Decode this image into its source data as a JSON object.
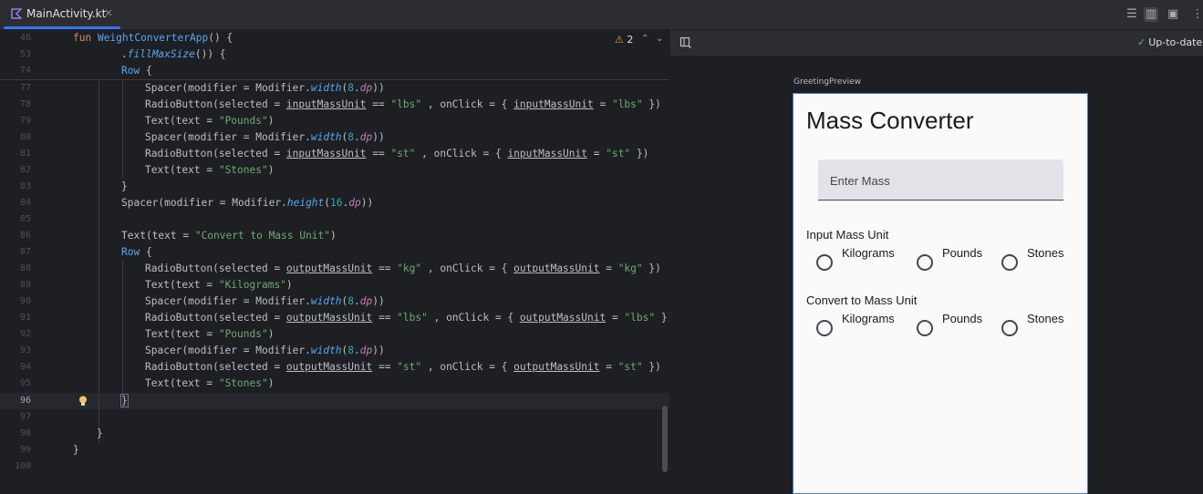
{
  "tab": {
    "file_name": "MainActivity.kt",
    "close": "×"
  },
  "toolbar": {
    "code_view": "☰",
    "split_view": "▥",
    "design_view": "▣",
    "more": "⋮"
  },
  "editor": {
    "warnings_count": "2",
    "warning_icon": "⚠",
    "nav_up": "⌃",
    "nav_down": "⌄",
    "line_numbers": [
      "46",
      "53",
      "74",
      "77",
      "78",
      "79",
      "80",
      "81",
      "82",
      "83",
      "84",
      "85",
      "86",
      "87",
      "88",
      "89",
      "90",
      "91",
      "92",
      "93",
      "94",
      "95",
      "96",
      "97",
      "98",
      "99",
      "100"
    ],
    "current_line": "96",
    "code": {
      "l46_kw": "fun ",
      "l46_fn": "WeightConverterApp",
      "l46_rest": "() {",
      "l53_dot": ".",
      "l53_fn": "fillMaxSize",
      "l53_rest": "()) {",
      "l74_row": "Row",
      "l74_rest": " {",
      "spacer_call": "Spacer(modifier = Modifier.",
      "width_fn": "width",
      "height_fn": "height",
      "dp_ext": "dp",
      "num_8": "8",
      "num_16": "16",
      "close_2": "))",
      "radio_open": "RadioButton(selected = ",
      "input_var": "inputMassUnit",
      "output_var": "outputMassUnit",
      "eq": " == ",
      "onclick": " , onClick = { ",
      "assign": " = ",
      "close_brace": " })",
      "str_lbs": "\"lbs\"",
      "str_st": "\"st\"",
      "str_kg": "\"kg\"",
      "text_open": "Text(text = ",
      "str_pounds": "\"Pounds\"",
      "str_stones": "\"Stones\"",
      "str_kilograms": "\"Kilograms\"",
      "str_convert": "\"Convert to Mass Unit\"",
      "close_paren": ")",
      "brace_close": "}",
      "row": "Row",
      "row_open": " {"
    }
  },
  "preview": {
    "status": "Up-to-date",
    "status_check": "✓",
    "preview_name": "GreetingPreview",
    "app": {
      "title": "Mass Converter",
      "mass_placeholder": "Enter Mass",
      "input_label": "Input Mass Unit",
      "output_label": "Convert to Mass Unit",
      "options": [
        "Kilograms",
        "Pounds",
        "Stones"
      ]
    }
  }
}
